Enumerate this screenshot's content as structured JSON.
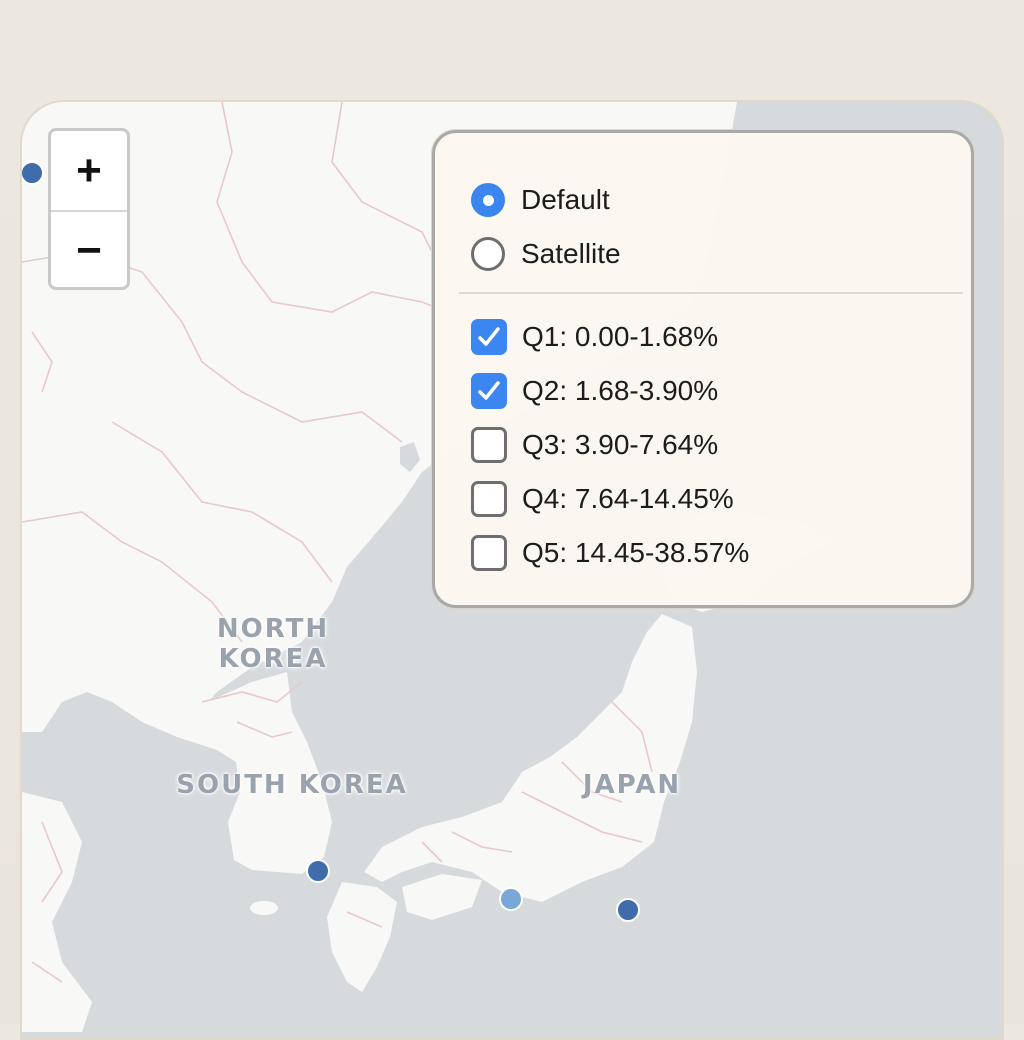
{
  "map": {
    "country_labels": {
      "north_korea": "NORTH\nKOREA",
      "south_korea": "SOUTH KOREA",
      "japan": "JAPAN"
    },
    "colors": {
      "water": "#d6dadd",
      "land": "#f8f8f6",
      "border": "#e9c8cb",
      "marker_dark": "#3f6dab",
      "marker_light": "#79a8d6"
    },
    "markers": [
      {
        "name": "marker-top-left-edge",
        "shade": "dark"
      },
      {
        "name": "marker-south-korea-coast",
        "shade": "dark"
      },
      {
        "name": "marker-japan-south-coast",
        "shade": "light"
      },
      {
        "name": "marker-pacific-offshore",
        "shade": "dark"
      }
    ]
  },
  "zoom": {
    "zoom_in_label": "+",
    "zoom_out_label": "−"
  },
  "layers": {
    "base_layers": [
      {
        "label": "Default",
        "selected": true
      },
      {
        "label": "Satellite",
        "selected": false
      }
    ],
    "overlays": [
      {
        "label": "Q1: 0.00-1.68%",
        "checked": true
      },
      {
        "label": "Q2: 1.68-3.90%",
        "checked": true
      },
      {
        "label": "Q3: 3.90-7.64%",
        "checked": false
      },
      {
        "label": "Q4: 7.64-14.45%",
        "checked": false
      },
      {
        "label": "Q5: 14.45-38.57%",
        "checked": false
      }
    ]
  }
}
